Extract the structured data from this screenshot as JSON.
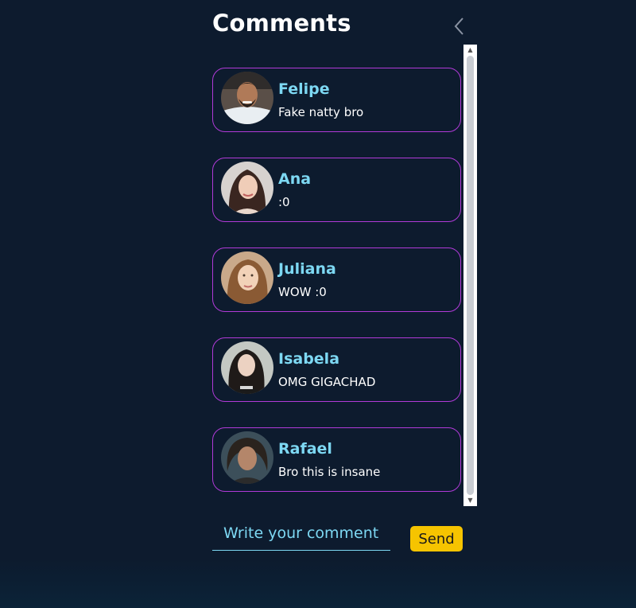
{
  "header": {
    "title": "Comments",
    "back_icon": "chevron-left-icon"
  },
  "comments": [
    {
      "name": "Felipe",
      "text": "Fake natty bro",
      "avatar": "avatar-photo"
    },
    {
      "name": "Ana",
      "text": ":0",
      "avatar": "avatar-photo"
    },
    {
      "name": "Juliana",
      "text": "WOW :0",
      "avatar": "avatar-photo"
    },
    {
      "name": "Isabela",
      "text": "OMG GIGACHAD",
      "avatar": "avatar-photo"
    },
    {
      "name": "Rafael",
      "text": "Bro this is insane",
      "avatar": "avatar-photo"
    }
  ],
  "composer": {
    "placeholder": "Write your comment",
    "value": "",
    "send_label": "Send"
  },
  "colors": {
    "background": "#0d1b2e",
    "card_border": "#b03ad8",
    "name": "#7dd8f3",
    "text": "#ffffff",
    "send_button": "#f6c400"
  }
}
